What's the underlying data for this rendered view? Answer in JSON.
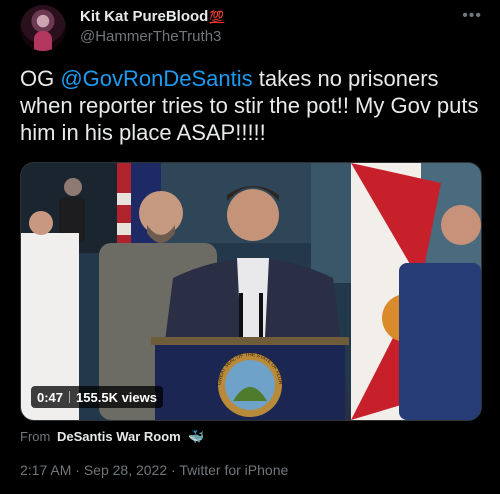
{
  "user": {
    "display_name": "Kit Kat PureBlood",
    "badge": "💯",
    "handle": "@HammerTheTruth3"
  },
  "tweet": {
    "text_before": "OG ",
    "mention": "@GovRonDeSantis",
    "text_after": " takes no prisoners when reporter tries to stir the pot!! My Gov puts him in his place ASAP!!!!!"
  },
  "video": {
    "duration": "0:47",
    "views": "155.5K views",
    "seal_text": "GREAT SEAL OF THE STATE OF FLORIDA"
  },
  "source": {
    "prefix": "From",
    "name": "DeSantis War Room",
    "icon": "whale-icon"
  },
  "meta": {
    "time": "2:17 AM",
    "date": "Sep 28, 2022",
    "client": "Twitter for iPhone",
    "separator": "·"
  },
  "icons": {
    "more": "more-icon"
  },
  "colors": {
    "link": "#1d9bf0",
    "background": "#000000",
    "muted": "#71767b"
  }
}
